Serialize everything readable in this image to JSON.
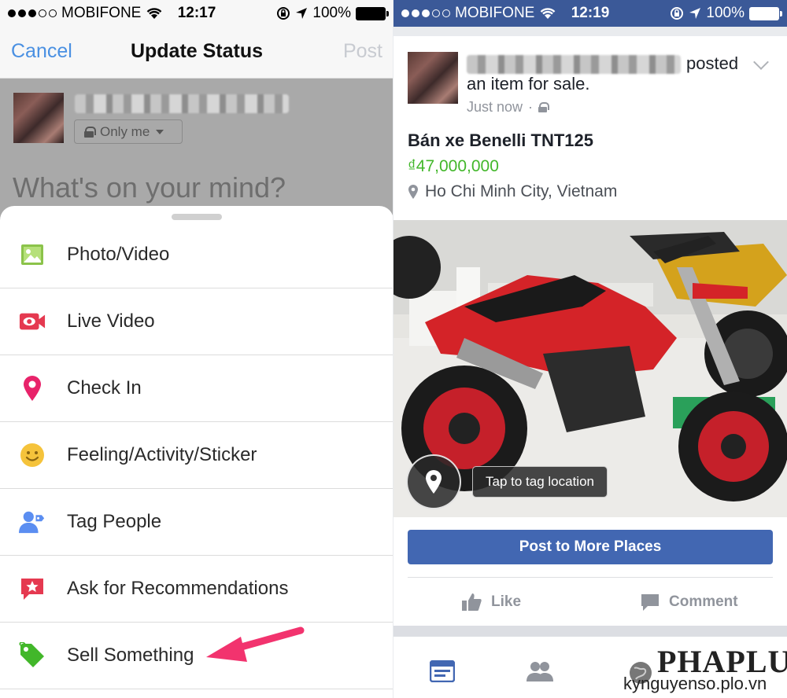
{
  "left": {
    "status": {
      "carrier": "MOBIFONE",
      "time": "12:17",
      "battery": "100%"
    },
    "nav": {
      "cancel": "Cancel",
      "title": "Update Status",
      "post": "Post"
    },
    "composer": {
      "privacy": "Only me",
      "placeholder": "What's on your mind?"
    },
    "menu": [
      {
        "label": "Photo/Video",
        "icon": "photo-icon",
        "color": "#8bc34a"
      },
      {
        "label": "Live Video",
        "icon": "live-video-icon",
        "color": "#e53950"
      },
      {
        "label": "Check In",
        "icon": "location-pin-icon",
        "color": "#e8236a"
      },
      {
        "label": "Feeling/Activity/Sticker",
        "icon": "smiley-icon",
        "color": "#f5c33b"
      },
      {
        "label": "Tag People",
        "icon": "tag-people-icon",
        "color": "#5b8ef1"
      },
      {
        "label": "Ask for Recommendations",
        "icon": "recommendation-icon",
        "color": "#e53950"
      },
      {
        "label": "Sell Something",
        "icon": "price-tag-icon",
        "color": "#42b72a"
      }
    ],
    "annotation_color": "#f2336e"
  },
  "right": {
    "status": {
      "carrier": "MOBIFONE",
      "time": "12:19",
      "battery": "100%"
    },
    "post": {
      "posted_text": "posted",
      "posted_text2": "an item for sale.",
      "time": "Just now",
      "item_title": "Bán xe Benelli TNT125",
      "price": "₫47,000,000",
      "location": "Ho Chi Minh City, Vietnam",
      "tag_location": "Tap to tag location",
      "more_places": "Post to More Places",
      "like": "Like",
      "comment": "Comment"
    },
    "watermark": {
      "logo": "PHAPLUAT",
      "url": "kynguyenso.plo.vn"
    },
    "brand_color": "#3b5998"
  }
}
